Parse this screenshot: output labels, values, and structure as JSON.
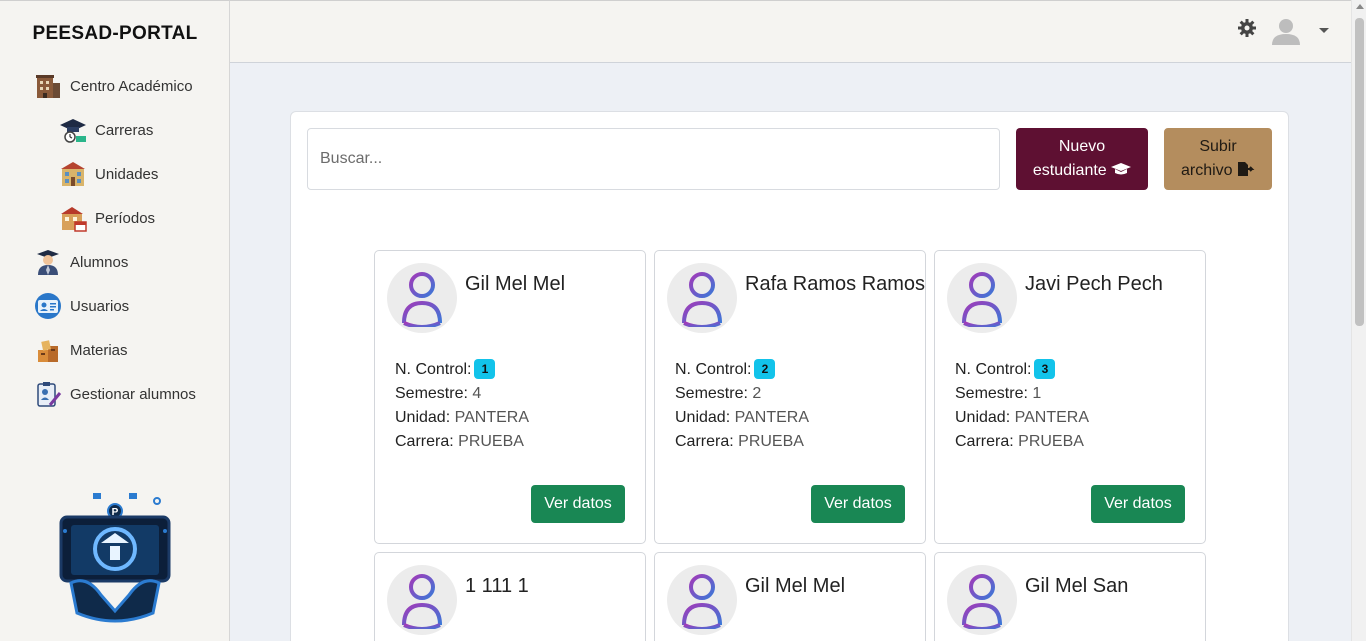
{
  "sidebar": {
    "brand": "PEESAD-PORTAL",
    "items": [
      {
        "label": "Centro Académico",
        "icon": "building-icon"
      },
      {
        "label": "Carreras",
        "icon": "graduation-cap-clock-icon"
      },
      {
        "label": "Unidades",
        "icon": "school-building-icon"
      },
      {
        "label": "Períodos",
        "icon": "calendar-building-icon"
      },
      {
        "label": "Alumnos",
        "icon": "student-icon"
      },
      {
        "label": "Usuarios",
        "icon": "id-card-icon"
      },
      {
        "label": "Materias",
        "icon": "books-icon"
      },
      {
        "label": "Gestionar alumnos",
        "icon": "clipboard-edit-icon"
      }
    ]
  },
  "topbar": {
    "settings_icon": "gear-icon",
    "user_icon": "user-avatar-icon"
  },
  "search": {
    "placeholder": "Buscar..."
  },
  "actions": {
    "new_line1": "Nuevo",
    "new_line2": "estudiante",
    "upload_line1": "Subir",
    "upload_line2": "archivo"
  },
  "labels": {
    "control": "N. Control:",
    "semester": "Semestre:",
    "unit": "Unidad:",
    "career": "Carrera:",
    "view": "Ver datos"
  },
  "students": [
    {
      "name": "Gil Mel Mel",
      "control": "1",
      "semester": "4",
      "unit": "PANTERA",
      "career": "PRUEBA"
    },
    {
      "name": "Rafa Ramos Ramos",
      "control": "2",
      "semester": "2",
      "unit": "PANTERA",
      "career": "PRUEBA"
    },
    {
      "name": "Javi Pech Pech",
      "control": "3",
      "semester": "1",
      "unit": "PANTERA",
      "career": "PRUEBA"
    },
    {
      "name": "1 111 1"
    },
    {
      "name": "Gil Mel Mel"
    },
    {
      "name": "Gil Mel San"
    }
  ],
  "colors": {
    "primary_button": "#5e1032",
    "secondary_button": "#b48d5e",
    "view_button": "#198754",
    "badge": "#12c3ea"
  }
}
